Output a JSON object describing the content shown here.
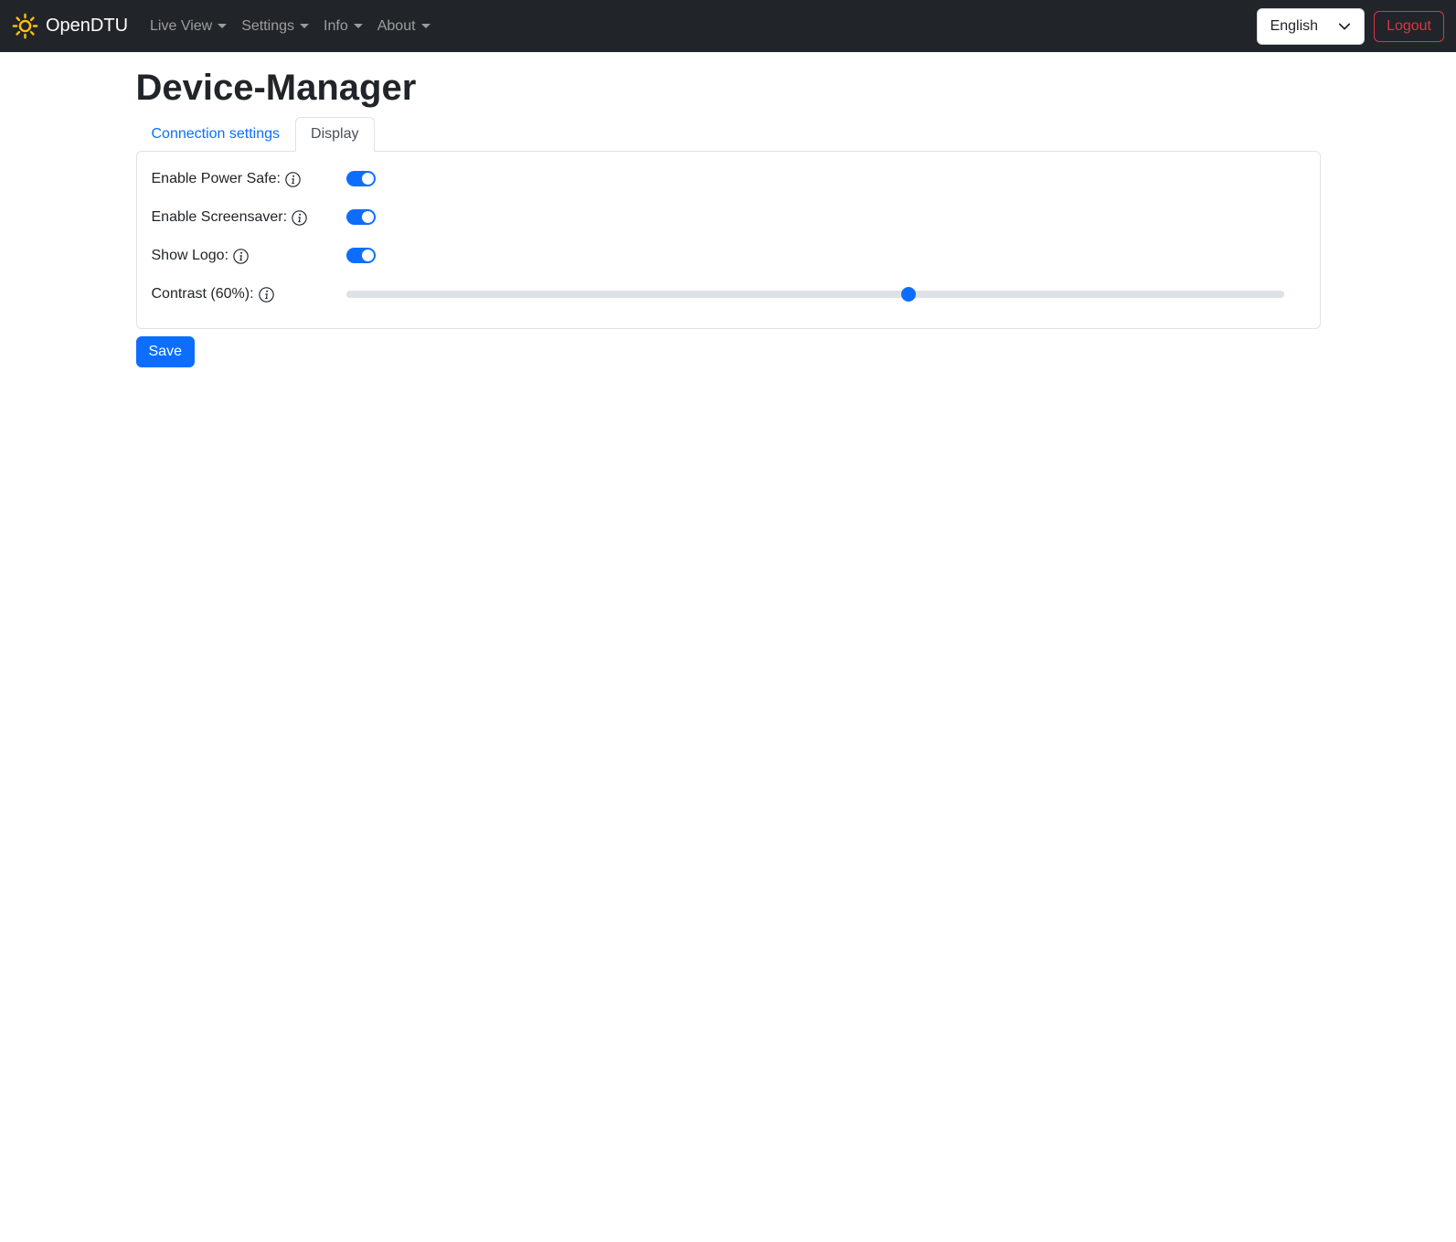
{
  "navbar": {
    "brand": "OpenDTU",
    "items": [
      {
        "label": "Live View",
        "dropdown": false
      },
      {
        "label": "Settings",
        "dropdown": true
      },
      {
        "label": "Info",
        "dropdown": true
      },
      {
        "label": "About",
        "dropdown": false
      }
    ],
    "language_selected": "English",
    "logout_label": "Logout"
  },
  "page": {
    "title": "Device-Manager",
    "tabs": [
      {
        "label": "Connection settings",
        "active": false
      },
      {
        "label": "Display",
        "active": true
      }
    ]
  },
  "form": {
    "rows": [
      {
        "label": "Enable Power Safe:",
        "info": true,
        "type": "switch",
        "on": true
      },
      {
        "label": "Enable Screensaver:",
        "info": true,
        "type": "switch",
        "on": true
      },
      {
        "label": "Show Logo:",
        "info": false,
        "type": "switch",
        "on": true
      },
      {
        "label": "Contrast (60%):",
        "info": false,
        "type": "range",
        "value_percent": 60
      }
    ],
    "save_label": "Save"
  },
  "colors": {
    "accent": "#0d6efd",
    "danger": "#dc3545",
    "navbar_bg": "#212529",
    "brand_icon": "#ffc107",
    "border": "#dee2e6"
  }
}
